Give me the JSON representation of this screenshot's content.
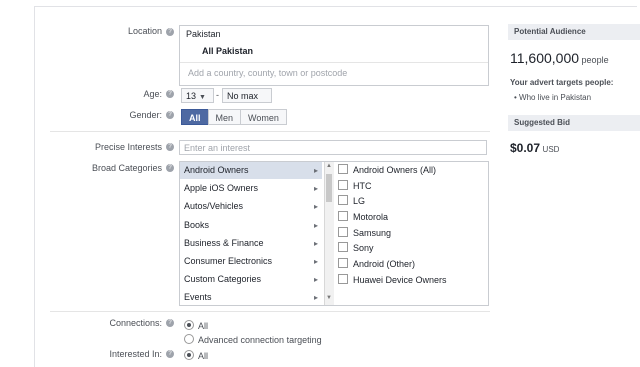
{
  "form": {
    "location_label": "Location",
    "location_country": "Pakistan",
    "location_scope": "All Pakistan",
    "location_placeholder": "Add a country, county, town or postcode",
    "age_label": "Age:",
    "age_min": "13",
    "age_dash": "-",
    "age_max": "No max",
    "gender_label": "Gender:",
    "gender_options": [
      "All",
      "Men",
      "Women"
    ],
    "precise_label": "Precise Interests",
    "precise_placeholder": "Enter an interest",
    "broad_label": "Broad Categories",
    "categories": [
      "Android Owners",
      "Apple iOS Owners",
      "Autos/Vehicles",
      "Books",
      "Business & Finance",
      "Consumer Electronics",
      "Custom Categories",
      "Events"
    ],
    "subcategories": [
      "Android Owners (All)",
      "HTC",
      "LG",
      "Motorola",
      "Samsung",
      "Sony",
      "Android (Other)",
      "Huawei Device Owners"
    ],
    "connections_label": "Connections:",
    "connections_options": [
      "All",
      "Advanced connection targeting"
    ],
    "interested_label": "Interested In:",
    "interested_option": "All"
  },
  "sidebar": {
    "potential_header": "Potential Audience",
    "audience_count": "11,600,000",
    "audience_unit": "people",
    "targets_heading": "Your advert targets people:",
    "targets_item": "Who live in Pakistan",
    "suggested_header": "Suggested Bid",
    "bid_value": "$0.07",
    "bid_currency": "USD"
  },
  "colors": {
    "accent": "#4e69a2",
    "selected_row": "#d8dfea"
  },
  "icons": {
    "help": "help-icon",
    "dropdown": "chevron-down-icon",
    "submenu": "chevron-right-icon",
    "bullet": "bullet-icon"
  }
}
